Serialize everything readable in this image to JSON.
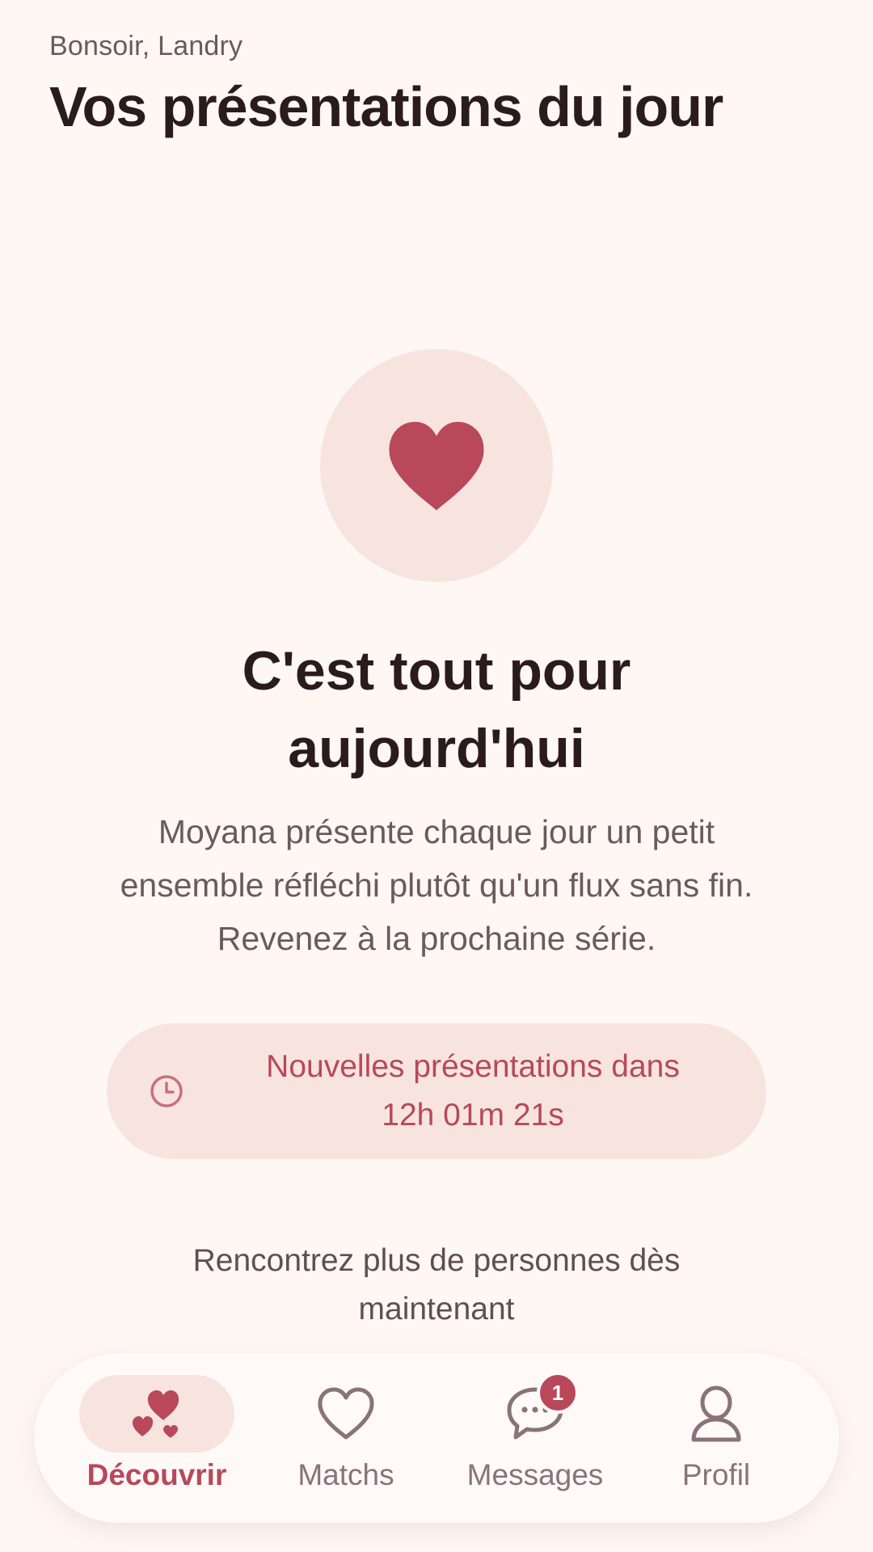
{
  "header": {
    "greeting": "Bonsoir, Landry",
    "title": "Vos présentations du jour"
  },
  "empty_state": {
    "icon": "heart-icon",
    "title": "C'est tout pour aujourd'hui",
    "description": "Moyana présente chaque jour un petit ensemble réfléchi plutôt qu'un flux sans fin. Revenez à la prochaine série."
  },
  "countdown": {
    "icon": "clock-icon",
    "label": "Nouvelles présentations dans",
    "time": "12h 01m 21s"
  },
  "meet_more": {
    "label": "Rencontrez plus de personnes dès maintenant"
  },
  "bottom_nav": {
    "items": [
      {
        "label": "Découvrir",
        "icon": "hearts-icon",
        "active": true
      },
      {
        "label": "Matchs",
        "icon": "heart-outline-icon",
        "active": false
      },
      {
        "label": "Messages",
        "icon": "chat-bubble-icon",
        "active": false,
        "badge": "1"
      },
      {
        "label": "Profil",
        "icon": "person-icon",
        "active": false
      }
    ]
  },
  "colors": {
    "background": "#fff7f4",
    "accent": "#b8485a",
    "accent_soft": "#f7e4df",
    "text_primary": "#2a1b1f",
    "text_secondary": "#6a5a5e",
    "nav_inactive": "#8a7377"
  }
}
